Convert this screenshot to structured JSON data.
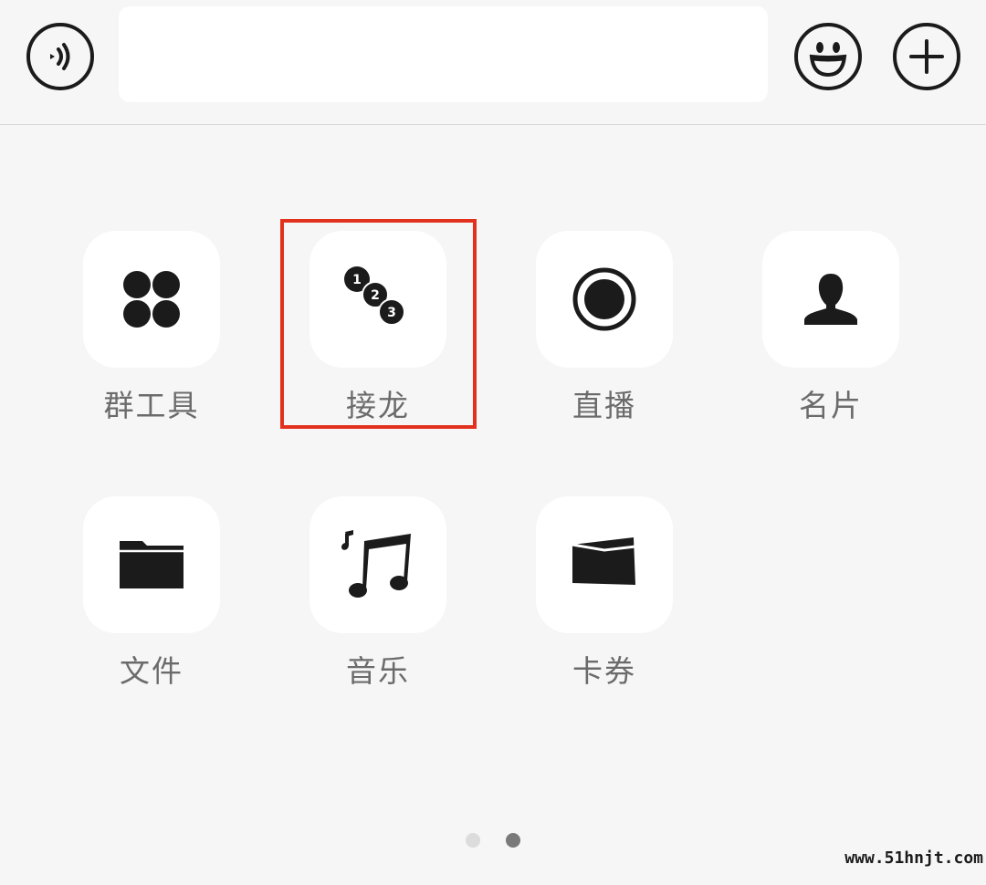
{
  "input_bar": {
    "voice_icon": "voice-input-icon",
    "emoji_icon": "smiley-face-icon",
    "plus_icon": "plus-icon",
    "text_value": ""
  },
  "grid": {
    "items": [
      {
        "label": "群工具",
        "icon": "four-dots-icon"
      },
      {
        "label": "接龙",
        "icon": "numbered-chain-icon",
        "badges": [
          "1",
          "2",
          "3"
        ]
      },
      {
        "label": "直播",
        "icon": "live-record-icon"
      },
      {
        "label": "名片",
        "icon": "person-card-icon"
      },
      {
        "label": "文件",
        "icon": "folder-icon"
      },
      {
        "label": "音乐",
        "icon": "music-note-icon"
      },
      {
        "label": "卡券",
        "icon": "coupon-icon"
      }
    ],
    "highlighted_index": 1,
    "highlight_color": "#e2321e"
  },
  "pagination": {
    "page_count": 2,
    "current_page": 2
  },
  "watermark": "www.51hnjt.com"
}
